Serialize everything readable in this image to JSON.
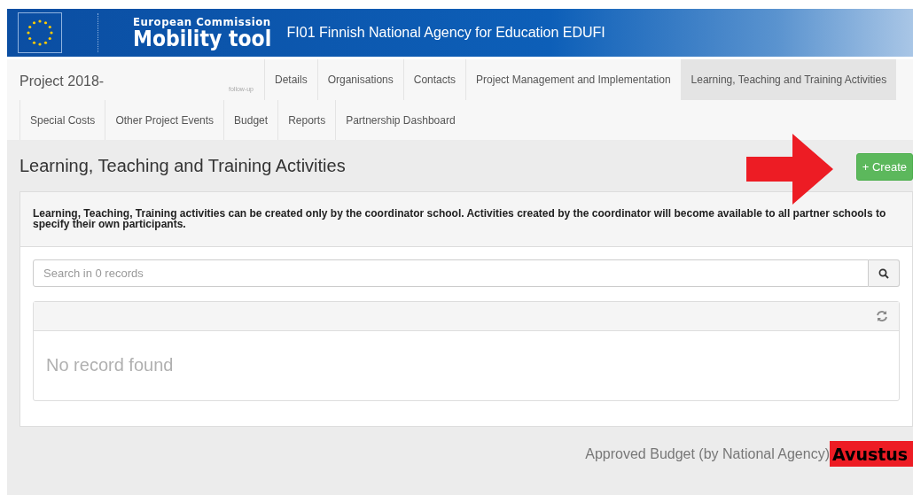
{
  "header": {
    "org": "European Commission",
    "app": "Mobility tool",
    "agency": "FI01 Finnish National Agency for Education EDUFI"
  },
  "nav": {
    "project": "Project 2018-",
    "follow_up": "follow-up",
    "tab_rows": [
      [
        {
          "label": "Details",
          "selected": false
        },
        {
          "label": "Organisations",
          "selected": false
        },
        {
          "label": "Contacts",
          "selected": false
        },
        {
          "label": "Project Management and Implementation",
          "selected": false
        },
        {
          "label": "Learning, Teaching and Training Activities",
          "selected": true
        }
      ],
      [
        {
          "label": "Special Costs",
          "selected": false
        },
        {
          "label": "Other Project Events",
          "selected": false
        },
        {
          "label": "Budget",
          "selected": false
        },
        {
          "label": "Reports",
          "selected": false
        },
        {
          "label": "Partnership Dashboard",
          "selected": false
        }
      ]
    ]
  },
  "page": {
    "title": "Learning, Teaching and Training Activities",
    "create_button": "+ Create",
    "notice": "Learning, Teaching, Training activities can be created only by the coordinator school. Activities created by the coordinator will become available to all partner schools to specify their own participants.",
    "search": {
      "placeholder": "Search in 0 records"
    },
    "empty_text": "No record found"
  },
  "footer": {
    "budget_label": "Approved Budget (by National Agency)",
    "annotation_label": "Avustus"
  }
}
